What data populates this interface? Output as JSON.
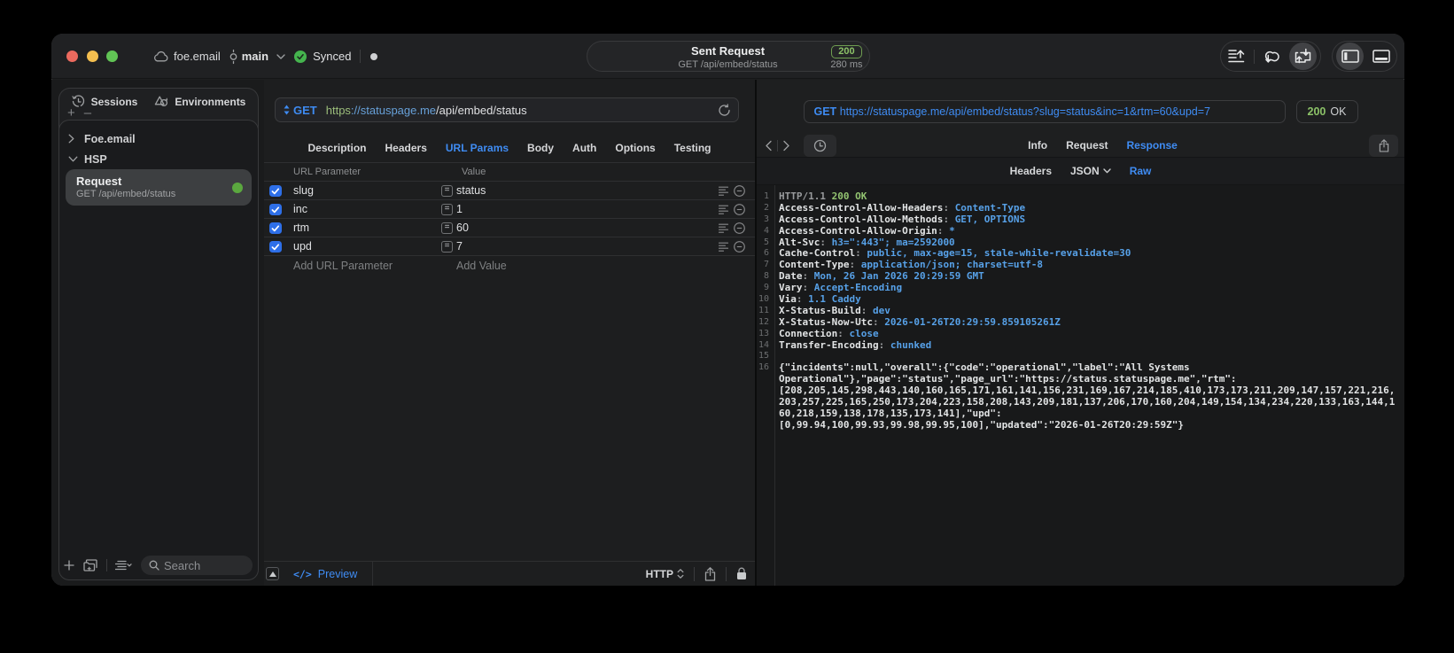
{
  "titlebar": {
    "project": "foe.email",
    "branch": "main",
    "sync_status": "Synced",
    "center": {
      "title": "Sent Request",
      "subtitle": "GET /api/embed/status",
      "status_code": "200",
      "duration": "280 ms"
    },
    "icons": [
      "cloud-icon",
      "commit-icon",
      "chevron-down-icon",
      "check-circle-icon",
      "publish-icon",
      "sync-icon",
      "transfer-icon",
      "layout-sidebar-icon",
      "layout-bottom-icon"
    ]
  },
  "sidebar": {
    "tabs": [
      {
        "label": "Sessions",
        "icon": "history-icon"
      },
      {
        "label": "Environments",
        "icon": "environments-icon"
      }
    ],
    "tree": [
      {
        "label": "Foe.email",
        "expanded": false
      },
      {
        "label": "HSP",
        "expanded": true
      }
    ],
    "selected_request": {
      "title": "Request",
      "subtitle": "GET /api/embed/status"
    },
    "search_placeholder": "Search"
  },
  "request_pane": {
    "method": "GET",
    "url_scheme": "https",
    "url_host": "://statuspage.me",
    "url_path": "/api/embed/status",
    "tabs": [
      "Description",
      "Headers",
      "URL Params",
      "Body",
      "Auth",
      "Options",
      "Testing"
    ],
    "active_tab": "URL Params",
    "params_table": {
      "columns": [
        "URL Parameter",
        "Value"
      ],
      "rows": [
        {
          "name": "slug",
          "value": "status",
          "enabled": true
        },
        {
          "name": "inc",
          "value": "1",
          "enabled": true
        },
        {
          "name": "rtm",
          "value": "60",
          "enabled": true
        },
        {
          "name": "upd",
          "value": "7",
          "enabled": true
        }
      ],
      "add_row": {
        "name_placeholder": "Add URL Parameter",
        "value_placeholder": "Add Value"
      }
    },
    "footer": {
      "preview_label": "Preview",
      "code_glyph": "</>",
      "protocol": "HTTP"
    }
  },
  "response_pane": {
    "request_line": {
      "method": "GET",
      "url": "https://statuspage.me/api/embed/status?slug=status&inc=1&rtm=60&upd=7"
    },
    "status": {
      "code": "200",
      "text": "OK"
    },
    "tabs": [
      "Info",
      "Request",
      "Response"
    ],
    "active_tab": "Response",
    "subtabs": [
      "Headers",
      "JSON",
      "Raw"
    ],
    "active_subtab": "Raw",
    "raw_lines": [
      {
        "n": "1",
        "s": [
          [
            "dim",
            "HTTP/1.1 "
          ],
          [
            "green",
            "200 OK"
          ]
        ]
      },
      {
        "n": "2",
        "s": [
          [
            "key",
            "Access-Control-Allow-Headers"
          ],
          [
            "dim",
            ": "
          ],
          [
            "val",
            "Content-Type"
          ]
        ]
      },
      {
        "n": "3",
        "s": [
          [
            "key",
            "Access-Control-Allow-Methods"
          ],
          [
            "dim",
            ": "
          ],
          [
            "val",
            "GET, OPTIONS"
          ]
        ]
      },
      {
        "n": "4",
        "s": [
          [
            "key",
            "Access-Control-Allow-Origin"
          ],
          [
            "dim",
            ": "
          ],
          [
            "val",
            "*"
          ]
        ]
      },
      {
        "n": "5",
        "s": [
          [
            "key",
            "Alt-Svc"
          ],
          [
            "dim",
            ": "
          ],
          [
            "val",
            "h3=\":443\"; ma=2592000"
          ]
        ]
      },
      {
        "n": "6",
        "s": [
          [
            "key",
            "Cache-Control"
          ],
          [
            "dim",
            ": "
          ],
          [
            "val",
            "public, max-age=15, stale-while-revalidate=30"
          ]
        ]
      },
      {
        "n": "7",
        "s": [
          [
            "key",
            "Content-Type"
          ],
          [
            "dim",
            ": "
          ],
          [
            "val",
            "application/json; charset=utf-8"
          ]
        ]
      },
      {
        "n": "8",
        "s": [
          [
            "key",
            "Date"
          ],
          [
            "dim",
            ": "
          ],
          [
            "val",
            "Mon, 26 Jan 2026 20:29:59 GMT"
          ]
        ]
      },
      {
        "n": "9",
        "s": [
          [
            "key",
            "Vary"
          ],
          [
            "dim",
            ": "
          ],
          [
            "val",
            "Accept-Encoding"
          ]
        ]
      },
      {
        "n": "10",
        "s": [
          [
            "key",
            "Via"
          ],
          [
            "dim",
            ": "
          ],
          [
            "val",
            "1.1 Caddy"
          ]
        ]
      },
      {
        "n": "11",
        "s": [
          [
            "key",
            "X-Status-Build"
          ],
          [
            "dim",
            ": "
          ],
          [
            "val",
            "dev"
          ]
        ]
      },
      {
        "n": "12",
        "s": [
          [
            "key",
            "X-Status-Now-Utc"
          ],
          [
            "dim",
            ": "
          ],
          [
            "val",
            "2026-01-26T20:29:59.859105261Z"
          ]
        ]
      },
      {
        "n": "13",
        "s": [
          [
            "key",
            "Connection"
          ],
          [
            "dim",
            ": "
          ],
          [
            "val",
            "close"
          ]
        ]
      },
      {
        "n": "14",
        "s": [
          [
            "key",
            "Transfer-Encoding"
          ],
          [
            "dim",
            ": "
          ],
          [
            "val",
            "chunked"
          ]
        ]
      },
      {
        "n": "15",
        "s": []
      },
      {
        "n": "16",
        "s": [
          [
            "body",
            "{\"incidents\":null,\"overall\":{\"code\":\"operational\",\"label\":\"All Systems"
          ]
        ]
      },
      {
        "n": "",
        "s": [
          [
            "body",
            "Operational\"},\"page\":\"status\",\"page_url\":\"https://status.statuspage.me\",\"rtm\":"
          ]
        ]
      },
      {
        "n": "",
        "s": [
          [
            "body",
            "[208,205,145,298,443,140,160,165,171,161,141,156,231,169,167,214,185,410,173,173,211,209,147,157,221,216,"
          ]
        ]
      },
      {
        "n": "",
        "s": [
          [
            "body",
            "203,257,225,165,250,173,204,223,158,208,143,209,181,137,206,170,160,204,149,154,134,234,220,133,163,144,1"
          ]
        ]
      },
      {
        "n": "",
        "s": [
          [
            "body",
            "60,218,159,138,178,135,173,141],\"upd\":"
          ]
        ]
      },
      {
        "n": "",
        "s": [
          [
            "body",
            "[0,99.94,100,99.93,99.98,99.95,100],\"updated\":\"2026-01-26T20:29:59Z\"}"
          ]
        ]
      }
    ]
  }
}
